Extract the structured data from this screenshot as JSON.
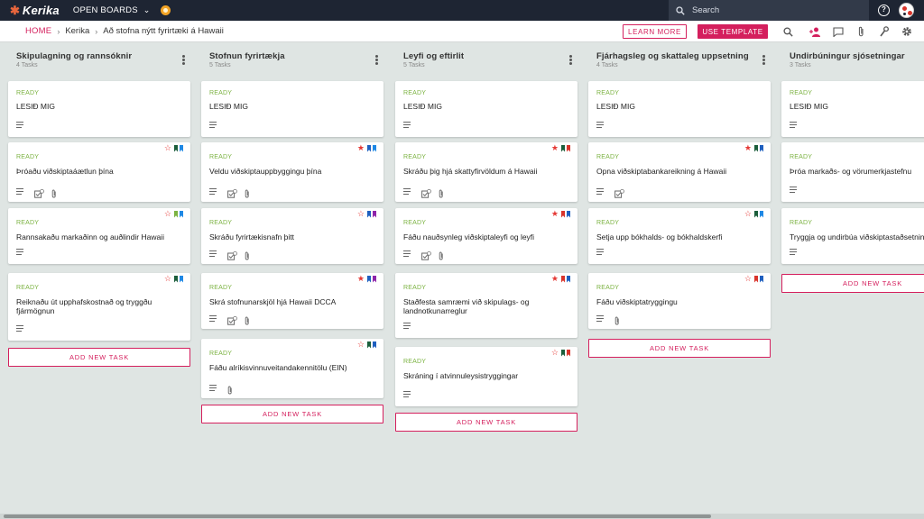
{
  "topbar": {
    "logo_text": "Kerika",
    "open_boards": "OPEN BOARDS",
    "search_placeholder": "Search"
  },
  "breadcrumb": {
    "home": "HOME",
    "org": "Kerika",
    "board": "Að stofna nýtt fyrirtæki á Hawaii"
  },
  "actions": {
    "learn_more": "LEARN MORE",
    "use_template": "USE TEMPLATE"
  },
  "colors": {
    "accent": "#d41f5d",
    "ready": "#7cb342",
    "topbar": "#1e2533",
    "board_bg": "#dfe5e3"
  },
  "add_task_label": "ADD NEW TASK",
  "columns": [
    {
      "title": "Skipulagning og rannsóknir",
      "count": "4 Tasks",
      "cards": [
        {
          "status": "READY",
          "title": "LESIÐ MIG",
          "star": "",
          "flags": [],
          "check": false,
          "clip": false
        },
        {
          "status": "READY",
          "title": "Þróaðu viðskiptaáætlun þína",
          "star": "outline",
          "flags": [
            "#1b5e3b",
            "#1e88e5"
          ],
          "check": true,
          "clip": true
        },
        {
          "status": "READY",
          "title": "Rannsakaðu markaðinn og auðlindir Hawaii",
          "star": "outline",
          "flags": [
            "#7cb342",
            "#1e88e5"
          ],
          "check": false,
          "clip": false
        },
        {
          "status": "READY",
          "title": "Reiknaðu út upphafskostnað og tryggðu fjármögnun",
          "star": "outline",
          "flags": [
            "#1b5e3b",
            "#1e88e5"
          ],
          "check": false,
          "clip": false
        }
      ]
    },
    {
      "title": "Stofnun fyrirtækja",
      "count": "5 Tasks",
      "cards": [
        {
          "status": "READY",
          "title": "LESIÐ MIG",
          "star": "",
          "flags": [],
          "check": false,
          "clip": false
        },
        {
          "status": "READY",
          "title": "Veldu viðskiptauppbyggingu þína",
          "star": "filled",
          "flags": [
            "#1e5fbf",
            "#1e88e5"
          ],
          "check": true,
          "clip": true
        },
        {
          "status": "READY",
          "title": "Skráðu fyrirtækisnafn þitt",
          "star": "outline",
          "flags": [
            "#1e5fbf",
            "#8e24aa"
          ],
          "check": true,
          "clip": true
        },
        {
          "status": "READY",
          "title": "Skrá stofnunarskjöl hjá Hawaii DCCA",
          "star": "filled",
          "flags": [
            "#1e5fbf",
            "#8e24aa"
          ],
          "check": true,
          "clip": true
        },
        {
          "status": "READY",
          "title": "Fáðu alríkisvinnuveitandakennitölu (EIN)",
          "star": "outline",
          "flags": [
            "#1b5e3b",
            "#1e5fbf"
          ],
          "check": false,
          "clip": true
        }
      ]
    },
    {
      "title": "Leyfi og eftirlit",
      "count": "5 Tasks",
      "cards": [
        {
          "status": "READY",
          "title": "LESIÐ MIG",
          "star": "",
          "flags": [],
          "check": false,
          "clip": false
        },
        {
          "status": "READY",
          "title": "Skráðu þig hjá skattyfirvöldum á Hawaii",
          "star": "filled",
          "flags": [
            "#1b5e3b",
            "#d9342b"
          ],
          "check": true,
          "clip": true
        },
        {
          "status": "READY",
          "title": "Fáðu nauðsynleg viðskiptaleyfi og leyfi",
          "star": "filled",
          "flags": [
            "#d9342b",
            "#1e5fbf"
          ],
          "check": true,
          "clip": true
        },
        {
          "status": "READY",
          "title": "Staðfesta samræmi við skipulags- og landnotkunarreglur",
          "star": "filled",
          "flags": [
            "#d9342b",
            "#1e5fbf"
          ],
          "check": false,
          "clip": false
        },
        {
          "status": "READY",
          "title": "Skráning í atvinnuleysistryggingar",
          "star": "outline",
          "flags": [
            "#1b5e3b",
            "#d9342b"
          ],
          "check": false,
          "clip": false
        }
      ]
    },
    {
      "title": "Fjárhagsleg og skattaleg uppsetning",
      "count": "4 Tasks",
      "cards": [
        {
          "status": "READY",
          "title": "LESIÐ MIG",
          "star": "",
          "flags": [],
          "check": false,
          "clip": false
        },
        {
          "status": "READY",
          "title": "Opna viðskiptabankareikning á Hawaii",
          "star": "filled",
          "flags": [
            "#1b5e3b",
            "#1e5fbf"
          ],
          "check": true,
          "clip": false
        },
        {
          "status": "READY",
          "title": "Setja upp bókhalds- og bókhaldskerfi",
          "star": "outline",
          "flags": [
            "#1b5e3b",
            "#1e88e5"
          ],
          "check": false,
          "clip": false
        },
        {
          "status": "READY",
          "title": "Fáðu viðskiptatryggingu",
          "star": "outline",
          "flags": [
            "#d9342b",
            "#1e5fbf"
          ],
          "check": false,
          "clip": true
        }
      ]
    },
    {
      "title": "Undirbúningur sjósetningar",
      "count": "3 Tasks",
      "cards": [
        {
          "status": "READY",
          "title": "LESIÐ MIG",
          "star": "",
          "flags": [],
          "check": false,
          "clip": false
        },
        {
          "status": "READY",
          "title": "Þróa markaðs- og vörumerkjastefnu",
          "star": "",
          "flags": [],
          "check": false,
          "clip": false
        },
        {
          "status": "READY",
          "title": "Tryggja og undirbúa viðskiptastaðsetningu",
          "star": "",
          "flags": [],
          "check": false,
          "clip": false
        }
      ]
    }
  ]
}
